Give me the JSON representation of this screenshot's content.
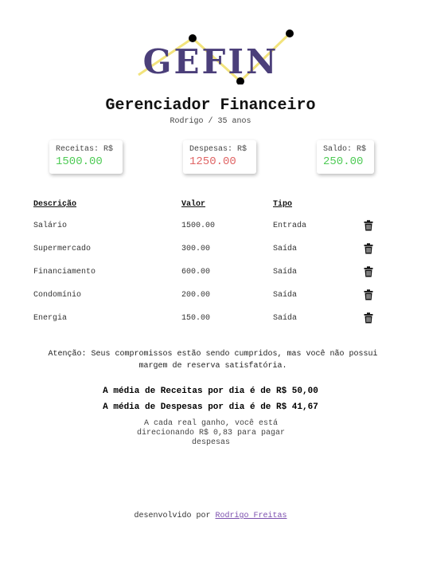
{
  "logo": {
    "text": "GEFIN",
    "text_color": "#4b3f7a",
    "line_color": "#f2e37c",
    "dot_color": "#000000"
  },
  "header": {
    "title": "Gerenciador Financeiro",
    "subtitle": "Rodrigo / 35 anos"
  },
  "summary": {
    "income": {
      "label": "Receitas: R$",
      "value": "1500.00",
      "color": "#4ecb55"
    },
    "expense": {
      "label": "Despesas: R$",
      "value": "1250.00",
      "color": "#e06565"
    },
    "balance": {
      "label": "Saldo: R$",
      "value": "250.00",
      "color": "#4ecb55"
    }
  },
  "table": {
    "headers": {
      "description": "Descrição",
      "value": "Valor",
      "type": "Tipo"
    },
    "rows": [
      {
        "description": "Salário",
        "value": "1500.00",
        "type": "Entrada",
        "kind": "income",
        "icon": "trash-icon"
      },
      {
        "description": "Supermercado",
        "value": "300.00",
        "type": "Saída",
        "kind": "expense",
        "icon": "trash-icon"
      },
      {
        "description": "Financiamento",
        "value": "600.00",
        "type": "Saída",
        "kind": "expense",
        "icon": "trash-icon"
      },
      {
        "description": "Condomínio",
        "value": "200.00",
        "type": "Saída",
        "kind": "expense",
        "icon": "trash-icon"
      },
      {
        "description": "Energia",
        "value": "150.00",
        "type": "Saída",
        "kind": "expense",
        "icon": "trash-icon"
      }
    ]
  },
  "analysis": {
    "notice": "Atenção: Seus compromissos estão sendo cumpridos, mas você não possui margem de reserva satisfatória.",
    "avg_income": "A média de Receitas por dia é de R$ 50,00",
    "avg_expense": "A média de Despesas por dia é de R$ 41,67",
    "ratio": "A cada real ganho, você está direcionando R$ 0,83 para pagar despesas"
  },
  "footer": {
    "prefix": "desenvolvido por",
    "link_text": "Rodrigo Freitas",
    "link_color": "#7b4fae"
  }
}
